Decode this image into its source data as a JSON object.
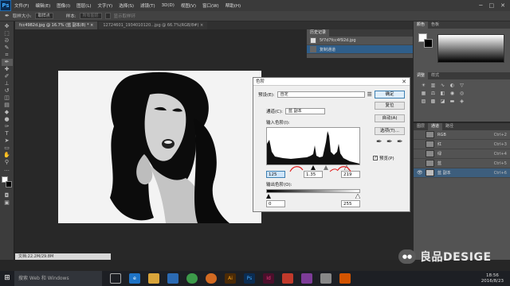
{
  "menubar": {
    "logo": "Ps",
    "items": [
      "文件(F)",
      "编辑(E)",
      "图像(I)",
      "图层(L)",
      "文字(Y)",
      "选择(S)",
      "滤镜(T)",
      "3D(D)",
      "视图(V)",
      "窗口(W)",
      "帮助(H)"
    ],
    "window_controls": [
      "─",
      "□",
      "✕"
    ]
  },
  "options": {
    "size_label": "取样大小:",
    "size_value": "取样点",
    "sample_label": "样本:",
    "sample_value": "所有图层",
    "ring_label": "显示取样环"
  },
  "tabs": [
    "fcc4982d.jpg @ 16.7% (蓝 副本/8) * ×",
    "12724601_1934010120...jpg @ 66.7%(RGB/8#) ×"
  ],
  "status": "文档:22.2M/29.8M",
  "levels": {
    "title": "色阶",
    "preset_label": "预设(E):",
    "preset_value": "自定",
    "channel_label": "通道(C):",
    "channel_value": "蓝 副本",
    "input_label": "输入色阶(I):",
    "output_label": "输出色阶(O):",
    "input_black": "125",
    "input_gamma": "1.35",
    "input_white": "219",
    "output_black": "0",
    "output_white": "255",
    "buttons": {
      "ok": "确定",
      "reset": "复位",
      "auto": "自动(A)",
      "options": "选项(T)..."
    },
    "preview_label": "预览(P)",
    "preview_checked": "✓"
  },
  "history_panel": {
    "tabs": [
      "历史记录"
    ],
    "items": [
      {
        "label": "5f7d7fcc4f92d.jpg"
      },
      {
        "label": "复制通道"
      }
    ]
  },
  "color_panel": {
    "tabs": [
      "颜色",
      "色板"
    ]
  },
  "adjust_panel": {
    "tabs": [
      "调整",
      "样式"
    ]
  },
  "channels_panel": {
    "tabs": [
      "图层",
      "通道",
      "路径"
    ],
    "rows": [
      {
        "name": "RGB",
        "shortcut": "Ctrl+2"
      },
      {
        "name": "红",
        "shortcut": "Ctrl+3"
      },
      {
        "name": "绿",
        "shortcut": "Ctrl+4"
      },
      {
        "name": "蓝",
        "shortcut": "Ctrl+5"
      },
      {
        "name": "蓝 副本",
        "shortcut": "Ctrl+6"
      }
    ]
  },
  "taskbar": {
    "start": "⊞",
    "search": "搜索 Web 和 Windows",
    "time": "18:56",
    "date": "2016/8/23"
  },
  "watermark": {
    "text": "良品DESIGE"
  }
}
